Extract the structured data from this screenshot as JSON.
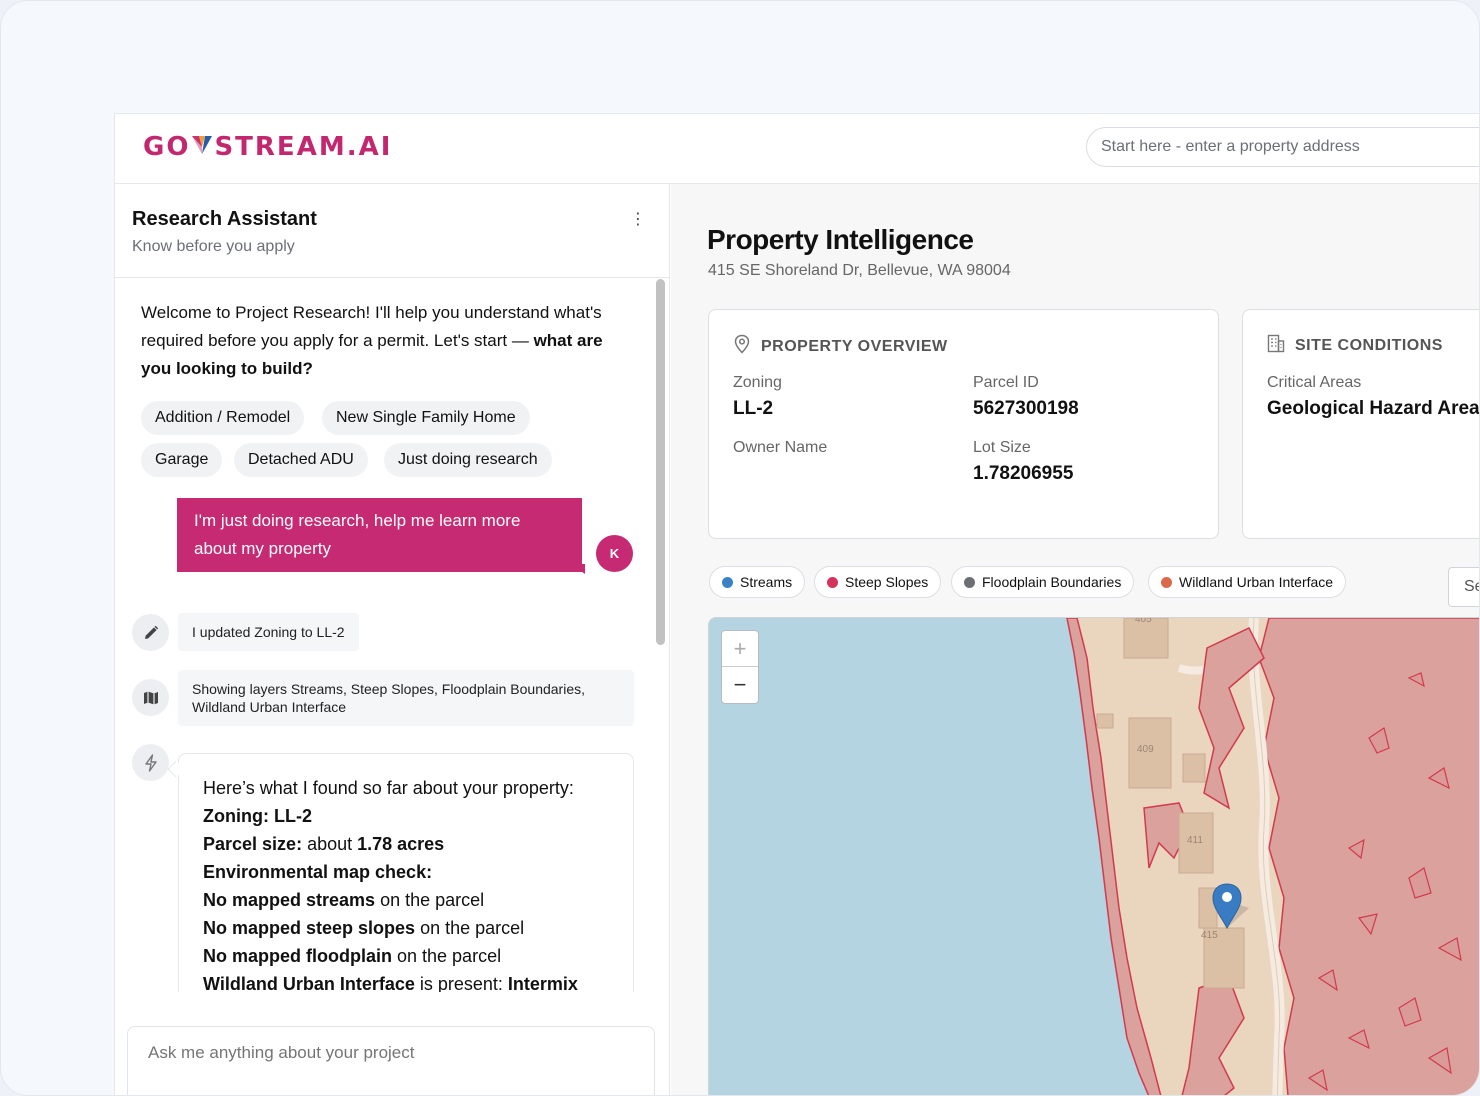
{
  "header": {
    "logo_left": "GO",
    "logo_right": "STREAM.AI",
    "search_placeholder": "Start here - enter a property address"
  },
  "assistant": {
    "title": "Research Assistant",
    "subtitle": "Know before you apply",
    "welcome_text": "Welcome to Project Research! I'll help you understand what's required before you apply for a permit. Let's start —",
    "welcome_question": "what are you looking to build?",
    "chips": [
      "Addition / Remodel",
      "New Single Family Home",
      "Garage",
      "Detached ADU",
      "Just doing research"
    ],
    "user_message": "I'm just doing research, help me learn more about my property",
    "user_initial": "K",
    "activity_zoning": "I updated Zoning to LL-2",
    "activity_layers": "Showing layers Streams, Steep Slopes, Floodplain Boundaries, Wildland Urban Interface",
    "result": {
      "intro": "Here’s what I found so far about your property:",
      "zoning_label": "Zoning: LL-2",
      "parcel_label": "Parcel size:",
      "parcel_text": " about ",
      "parcel_value": "1.78 acres",
      "env_label": "Environmental map check:",
      "streams_bold": "No mapped streams",
      "streams_text": " on the parcel",
      "slopes_bold": "No mapped steep slopes",
      "slopes_text": " on the parcel",
      "flood_bold": "No mapped floodplain",
      "flood_text": " on the parcel",
      "wui_bold": "Wildland Urban Interface",
      "wui_text": " is present: ",
      "wui_value": "Intermix"
    },
    "ask_placeholder": "Ask me anything about your project"
  },
  "property": {
    "title": "Property Intelligence",
    "address": "415 SE Shoreland Dr, Bellevue, WA 98004",
    "overview": {
      "heading": "PROPERTY OVERVIEW",
      "zoning_label": "Zoning",
      "zoning_value": "LL-2",
      "parcel_label": "Parcel ID",
      "parcel_value": "5627300198",
      "owner_label": "Owner Name",
      "lot_label": "Lot Size",
      "lot_value": "1.78206955"
    },
    "site": {
      "heading": "SITE CONDITIONS",
      "critical_label": "Critical Areas",
      "critical_value": "Geological Hazard Areas"
    },
    "layers": [
      {
        "name": "Streams",
        "color": "#3b82c4"
      },
      {
        "name": "Steep Slopes",
        "color": "#d6335a"
      },
      {
        "name": "Floodplain Boundaries",
        "color": "#6b6f74"
      },
      {
        "name": "Wildland Urban Interface",
        "color": "#d9694a"
      }
    ],
    "se_button": "Se",
    "map": {
      "water_color": "#b3d4e0",
      "land_color": "#ead5bf",
      "hazard_color": "#d99a98",
      "building_labels": [
        "409",
        "411",
        "415",
        "405"
      ],
      "zoom_in": "+",
      "zoom_out": "−"
    }
  }
}
